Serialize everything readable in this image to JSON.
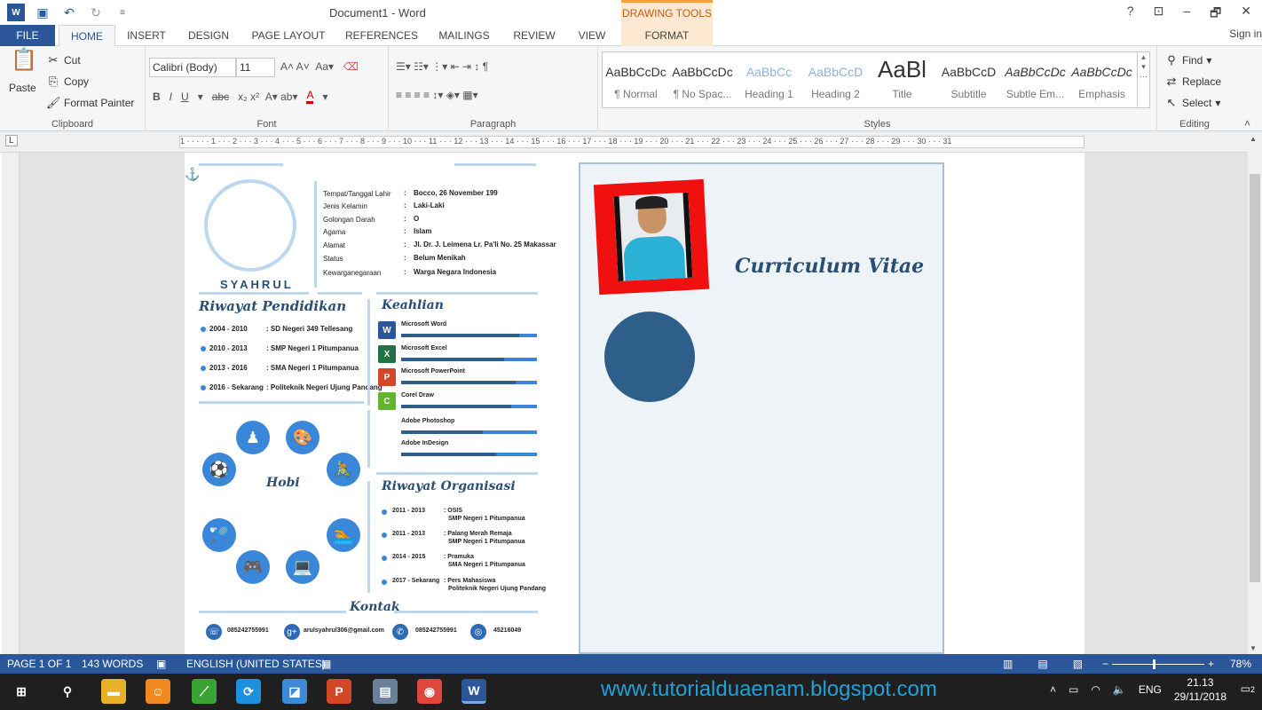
{
  "titlebar": {
    "doc_title": "Document1 - Word",
    "drawing_tools": "DRAWING TOOLS",
    "help": "?",
    "restore": "⊡",
    "minimize": "–",
    "maximize": "🗗",
    "close": "✕"
  },
  "tabs": [
    "FILE",
    "HOME",
    "INSERT",
    "DESIGN",
    "PAGE LAYOUT",
    "REFERENCES",
    "MAILINGS",
    "REVIEW",
    "VIEW",
    "FORMAT"
  ],
  "sign_in": "Sign in",
  "clipboard": {
    "paste": "Paste",
    "cut": "Cut",
    "copy": "Copy",
    "format_painter": "Format Painter",
    "label": "Clipboard"
  },
  "font": {
    "name": "Calibri (Body)",
    "size": "11",
    "label": "Font"
  },
  "paragraph": {
    "label": "Paragraph"
  },
  "styles": {
    "label": "Styles",
    "items": [
      {
        "preview": "AaBbCcDc",
        "name": "¶ Normal"
      },
      {
        "preview": "AaBbCcDc",
        "name": "¶ No Spac..."
      },
      {
        "preview": "AaBbCc",
        "name": "Heading 1"
      },
      {
        "preview": "AaBbCcD",
        "name": "Heading 2"
      },
      {
        "preview": "AaBl",
        "name": "Title"
      },
      {
        "preview": "AaBbCcD",
        "name": "Subtitle"
      },
      {
        "preview": "AaBbCcDc",
        "name": "Subtle Em..."
      },
      {
        "preview": "AaBbCcDc",
        "name": "Emphasis"
      }
    ]
  },
  "editing": {
    "find": "Find",
    "replace": "Replace",
    "select": "Select",
    "label": "Editing"
  },
  "ruler_text": "1 · · · · · 1 · · · 2 · · · 3 · · · 4 · · · 5 · · · 6 · · · 7 · · · 8 · · · 9 · · · 10 · · · 11 · · · 12 · · · 13 · · · 14 · · · 15 · · · 16 · · · 17 · · · 18 · · · 19 · · · 20 · · · 21 · · · 22 · · · 23 · · · 24 · · · 25 · · · 26 · · · 27 · · · 28 · · · 29 · · · 30 · · · 31",
  "resume": {
    "name": "SYAHRUL",
    "info": [
      {
        "k": "Tempat/Tanggal Lahir",
        "v": "Bocco, 26 November 199"
      },
      {
        "k": "Jenis Kelamin",
        "v": "Laki-Laki"
      },
      {
        "k": "Golongan Darah",
        "v": "O"
      },
      {
        "k": "Agama",
        "v": "Islam"
      },
      {
        "k": "Alamat",
        "v": "Jl. Dr. J. Leimena Lr. Pa'li No. 25 Makassar"
      },
      {
        "k": "Status",
        "v": "Belum Menikah"
      },
      {
        "k": "Kewarganegaraan",
        "v": "Warga Negara Indonesia"
      }
    ],
    "pendidikan_title": "Riwayat Pendidikan",
    "pendidikan": [
      {
        "y": "2004 - 2010",
        "s": ": SD Negeri 349 Tellesang"
      },
      {
        "y": "2010 - 2013",
        "s": ": SMP Negeri 1 Pitumpanua"
      },
      {
        "y": "2013 - 2016",
        "s": ": SMA Negeri 1 Pitumpanua"
      },
      {
        "y": "2016 - Sekarang",
        "s": ": Politeknik Negeri Ujung Pandang"
      }
    ],
    "keahlian_title": "Keahlian",
    "keahlian": [
      {
        "n": "Microsoft Word",
        "lvl": 0.87,
        "icon": "W",
        "color": "#2b579a"
      },
      {
        "n": "Microsoft Excel",
        "lvl": 0.76,
        "icon": "X",
        "color": "#217346"
      },
      {
        "n": "Microsoft PowerPoint",
        "lvl": 0.84,
        "icon": "P",
        "color": "#d24726"
      },
      {
        "n": "Corel Draw",
        "lvl": 0.81,
        "icon": "C",
        "color": "#62b52f"
      },
      {
        "n": "Adobe Photoshop",
        "lvl": 0.6,
        "icon": "",
        "color": "#fff"
      },
      {
        "n": "Adobe InDesign",
        "lvl": 0.7,
        "icon": "",
        "color": "#fff"
      }
    ],
    "hobi_title": "Hobi",
    "organisasi_title": "Riwayat Organisasi",
    "organisasi": [
      {
        "y": "2011 - 2013",
        "a": ": OSIS",
        "b": "SMP Negeri 1 Pitumpanua"
      },
      {
        "y": "2011 - 2013",
        "a": ": Palang Merah Remaja",
        "b": "SMP Negeri 1 Pitumpanua"
      },
      {
        "y": "2014 - 2015",
        "a": ": Pramuka",
        "b": "SMA Negeri 1 Pitumpanua"
      },
      {
        "y": "2017 - Sekarang",
        "a": ": Pers Mahasiswa",
        "b": "Politeknik Negeri Ujung Pandang"
      }
    ],
    "kontak_title": "Kontak",
    "kontak": [
      {
        "icon": "☏",
        "v": "085242755991"
      },
      {
        "icon": "g+",
        "v": "arulsyahrul306@gmail.com"
      },
      {
        "icon": "✆",
        "v": "085242755991"
      },
      {
        "icon": "◎",
        "v": "45216049"
      }
    ],
    "cv_title": "Curriculum Vitae"
  },
  "status": {
    "page": "PAGE 1 OF 1",
    "words": "143 WORDS",
    "lang": "ENGLISH (UNITED STATES)",
    "zoom": "78%"
  },
  "taskbar": {
    "blog": "www.tutorialduaenam.blogspot.com",
    "lang": "ENG",
    "time": "21.13",
    "date": "29/11/2018",
    "notif": "2"
  },
  "colors": {
    "accent": "#2b579a",
    "resume_blue": "#3a86d8",
    "cv_navy": "#2a4f74",
    "photo_bg": "#f01010"
  }
}
